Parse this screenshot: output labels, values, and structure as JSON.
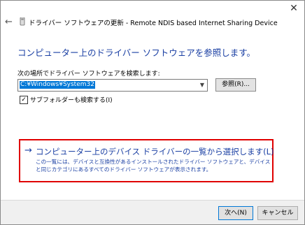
{
  "window": {
    "title": "ドライバー ソフトウェアの更新 - Remote NDIS based Internet Sharing Device"
  },
  "icons": {
    "close": "close-icon",
    "back": "back-arrow-icon",
    "device": "device-icon",
    "dropdown": "chevron-down-icon",
    "link_arrow": "arrow-right-icon"
  },
  "main": {
    "heading": "コンピューター上のドライバー ソフトウェアを参照します。",
    "search_label": "次の場所でドライバー ソフトウェアを検索します:",
    "path_value": "C:¥Windows¥System32",
    "browse_label": "参照(R)...",
    "subfolder_label": "サブフォルダーも検索する(I)",
    "subfolder_checked": true
  },
  "pick": {
    "title": "コンピューター上のデバイス ドライバーの一覧から選択します(L)",
    "description": "この一覧には、デバイスと互換性があるインストールされたドライバー ソフトウェアと、デバイスと同じカテゴリにあるすべてのドライバー ソフトウェアが表示されます。"
  },
  "footer": {
    "next_label": "次へ(N)",
    "cancel_label": "キャンセル"
  },
  "colors": {
    "accent": "#1a3fa3",
    "highlight": "#e00000",
    "selection": "#0078d7"
  }
}
